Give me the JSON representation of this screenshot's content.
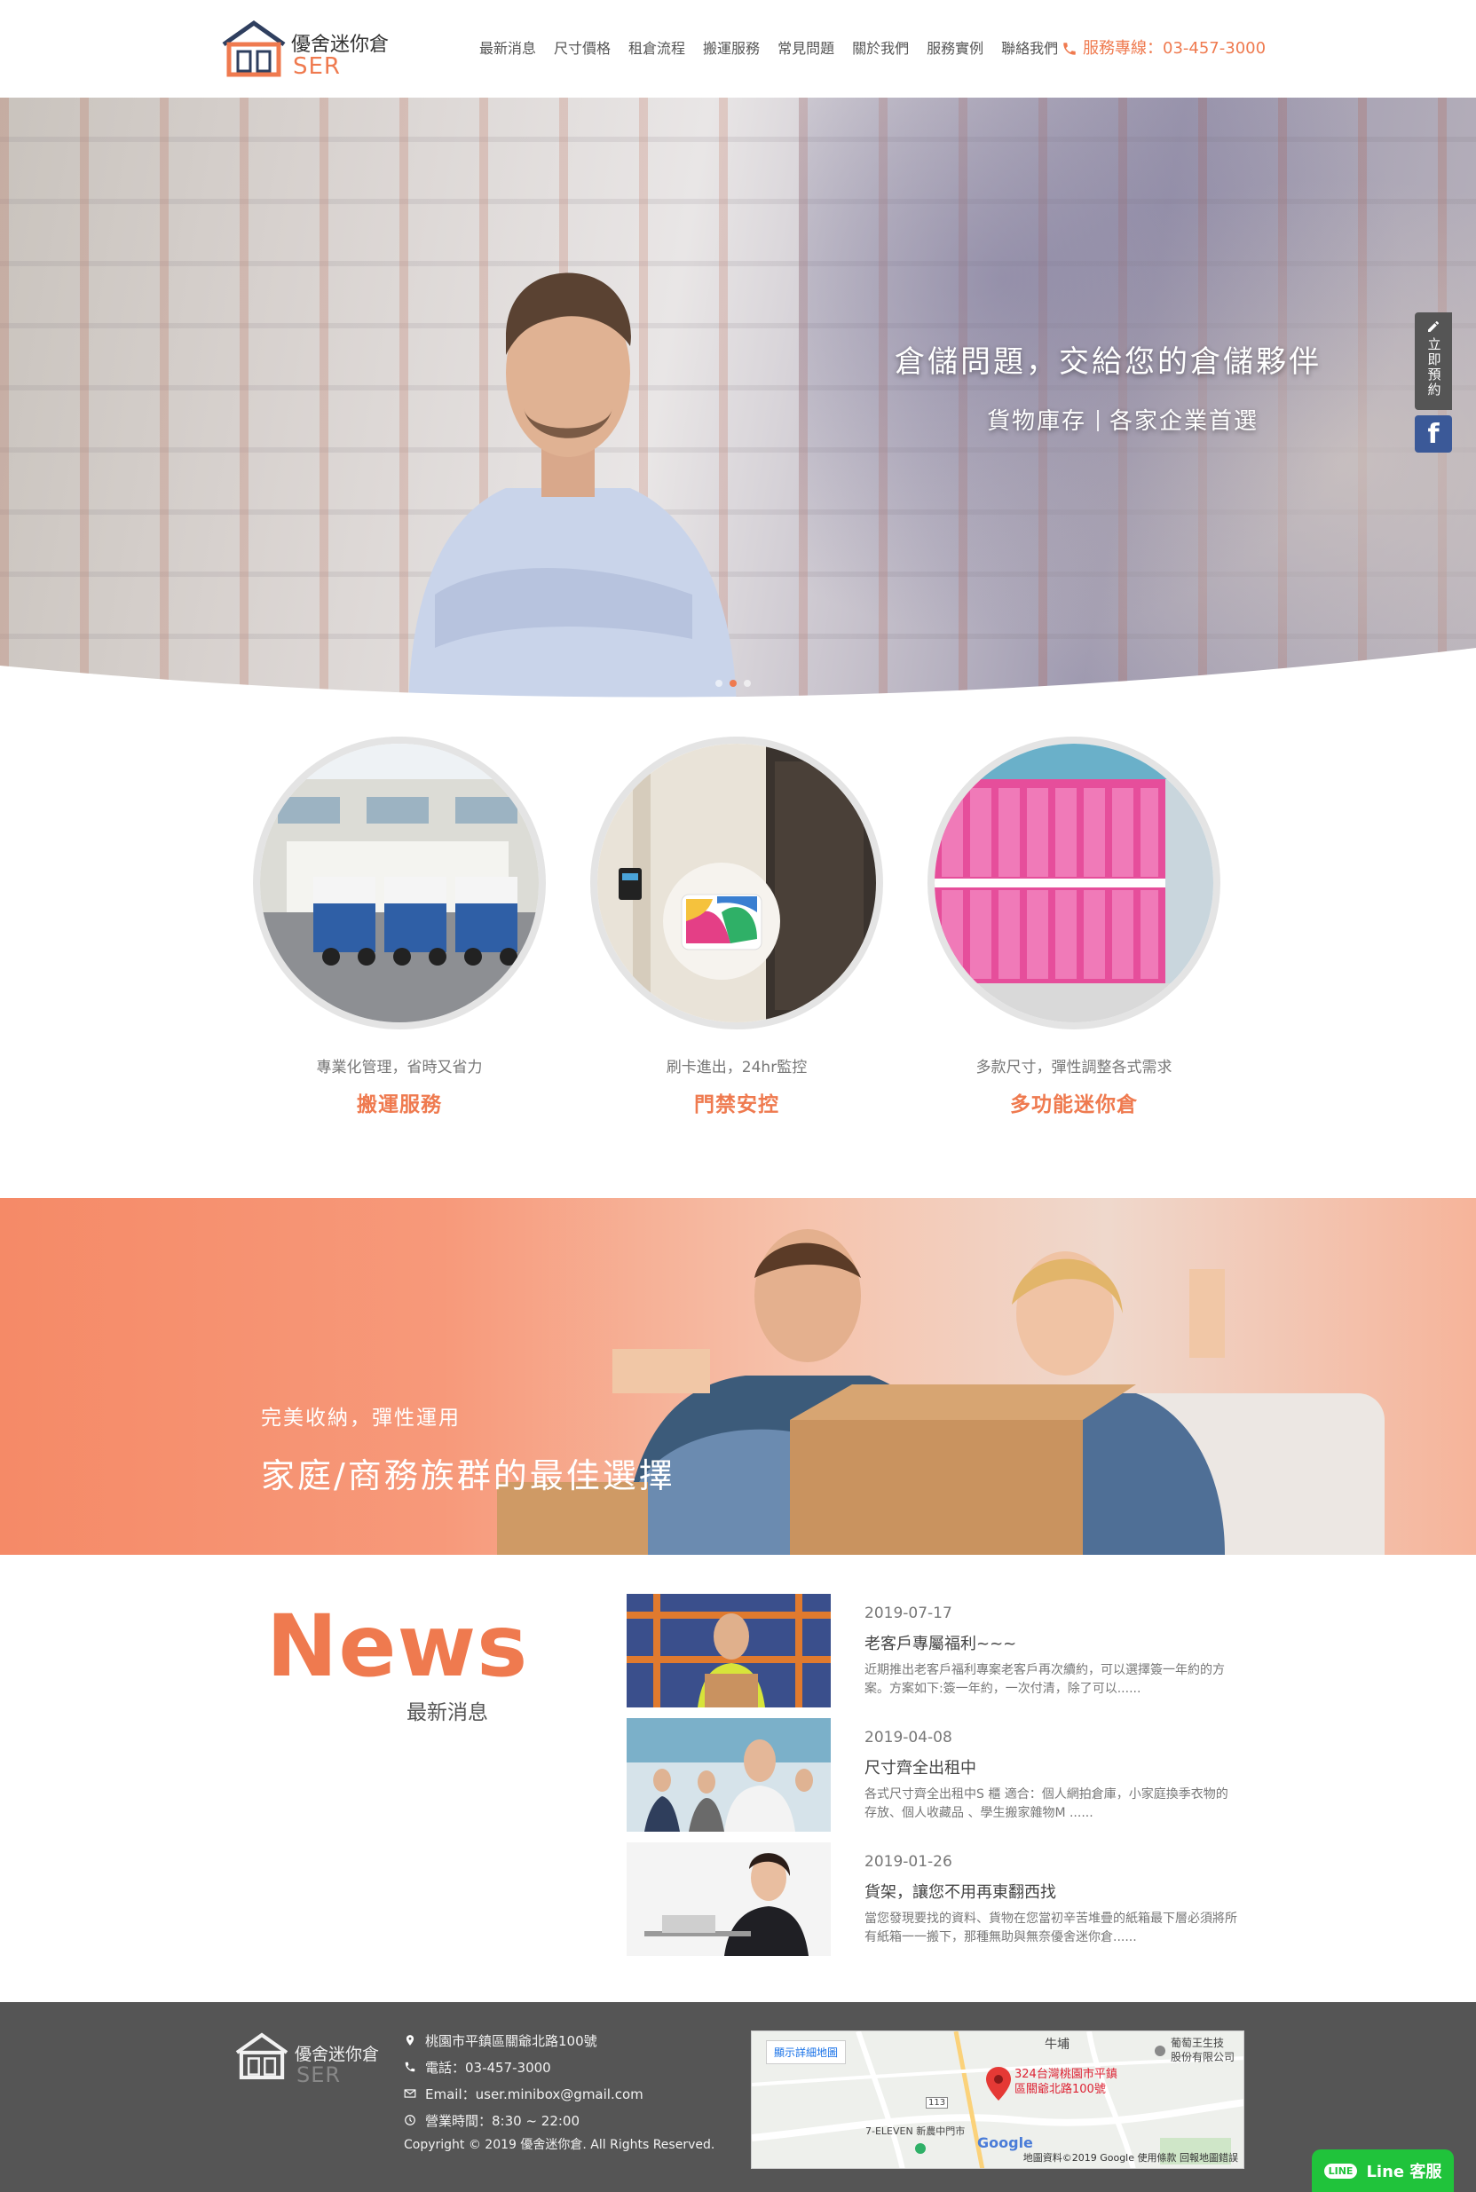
{
  "brand": {
    "name": "優舍迷你倉",
    "sub": "SER"
  },
  "nav": {
    "items": [
      {
        "label": "最新消息"
      },
      {
        "label": "尺寸價格"
      },
      {
        "label": "租倉流程"
      },
      {
        "label": "搬運服務"
      },
      {
        "label": "常見問題"
      },
      {
        "label": "關於我們"
      },
      {
        "label": "服務實例"
      },
      {
        "label": "聯絡我們"
      }
    ],
    "phone": "服務專線：03-457-3000"
  },
  "hero": {
    "title": "倉儲問題，交給您的倉儲夥伴",
    "sub_left": "貨物庫存",
    "sub_right": "各家企業首選",
    "slide_count": 3,
    "active_slide": 1
  },
  "side": {
    "reserve_label": "立即預約",
    "facebook": "f"
  },
  "features": [
    {
      "desc": "專業化管理，省時又省力",
      "title": "搬運服務",
      "icon": "warehouse-trucks-photo"
    },
    {
      "desc": "刷卡進出，24hr監控",
      "title": "門禁安控",
      "icon": "card-access-photo"
    },
    {
      "desc": "多款尺寸，彈性調整各式需求",
      "title": "多功能迷你倉",
      "icon": "pink-lockers-photo"
    }
  ],
  "banner": {
    "sub": "完美收納，彈性運用",
    "title": "家庭/商務族群的最佳選擇"
  },
  "news": {
    "heading": "News",
    "subheading": "最新消息",
    "items": [
      {
        "date": "2019-07-17",
        "title": "老客戶專屬福利~~~",
        "excerpt": "近期推出老客戶福利專案老客戶再次續約，可以選擇簽一年約的方案。方案如下:簽一年約，一次付清，除了可以......"
      },
      {
        "date": "2019-04-08",
        "title": "尺寸齊全出租中",
        "excerpt": "各式尺寸齊全出租中S 櫃 適合：個人網拍倉庫，小家庭換季衣物的存放、個人收藏品 、學生搬家雜物M ......"
      },
      {
        "date": "2019-01-26",
        "title": "貨架，讓您不用再東翻西找",
        "excerpt": "當您發現要找的資料、貨物在您當初辛苦堆疊的紙箱最下層必須將所有紙箱一一搬下，那種無助與無奈優舍迷你倉......"
      }
    ]
  },
  "footer": {
    "address": "桃園市平鎮區關爺北路100號",
    "phone": "電話：03-457-3000",
    "email": "Email：user.minibox@gmail.com",
    "hours": "營業時間：8:30 ~ 22:00",
    "copyright": "Copyright © 2019 優舍迷你倉. All Rights Reserved."
  },
  "map": {
    "button": "顯示詳細地圖",
    "pin_line1": "324台灣桃園市平鎮",
    "pin_line2": "區關爺北路100號",
    "place1": "牛埔",
    "place2": "葡萄王生技",
    "place3": "股份有限公司",
    "place4": "7-ELEVEN 新農中門市",
    "road": "113",
    "google": "Google",
    "attribution": "地圖資料©2019 Google   使用條款   回報地圖錯誤"
  },
  "line": {
    "badge": "LINE",
    "label": "Line 客服"
  },
  "colors": {
    "accent": "#ef7a4f",
    "footer_bg": "#555555",
    "line_green": "#20c33b",
    "facebook": "#3b5998"
  }
}
